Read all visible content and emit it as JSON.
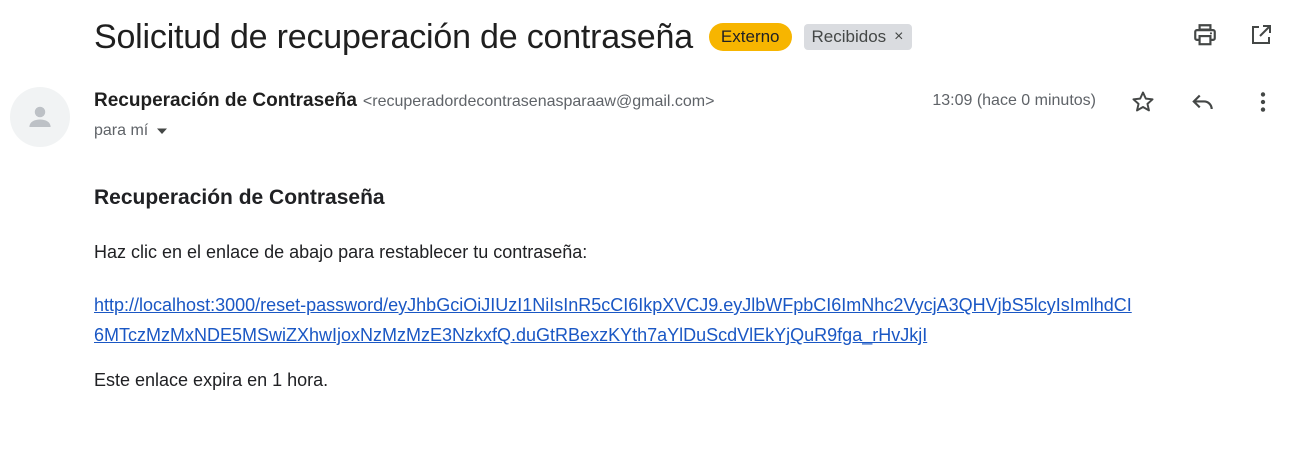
{
  "email": {
    "subject": "Solicitud de recuperación de contraseña",
    "external_badge": "Externo",
    "label": "Recibidos",
    "label_remove": "×",
    "sender_name": "Recuperación de Contraseña",
    "sender_email": "<recuperadordecontrasenasparaaw@gmail.com>",
    "to": "para mí",
    "timestamp": "13:09 (hace 0 minutos)"
  },
  "body": {
    "heading": "Recuperación de Contraseña",
    "instructions": "Haz clic en el enlace de abajo para restablecer tu contraseña:",
    "link": "http://localhost:3000/reset-password/eyJhbGciOiJIUzI1NiIsInR5cCI6IkpXVCJ9.eyJlbWFpbCI6ImNhc2VycjA3QHVjbS5lcyIsImlhdCI6MTczMzMxNDE5MSwiZXhwIjoxNzMzMzE3NzkxfQ.duGtRBexzKYth7aYlDuScdVlEkYjQuR9fga_rHvJkjI",
    "expiry": "Este enlace expira en 1 hora."
  },
  "icons": {
    "print": "print-icon",
    "open_new_window": "open-in-new-icon",
    "avatar": "person-icon",
    "star": "star-icon",
    "reply": "reply-icon",
    "more": "more-vert-icon",
    "dropdown": "chevron-down-icon"
  },
  "colors": {
    "external_badge": "#f7b500",
    "label_bg": "#dadce0",
    "link": "#1a57c4"
  }
}
